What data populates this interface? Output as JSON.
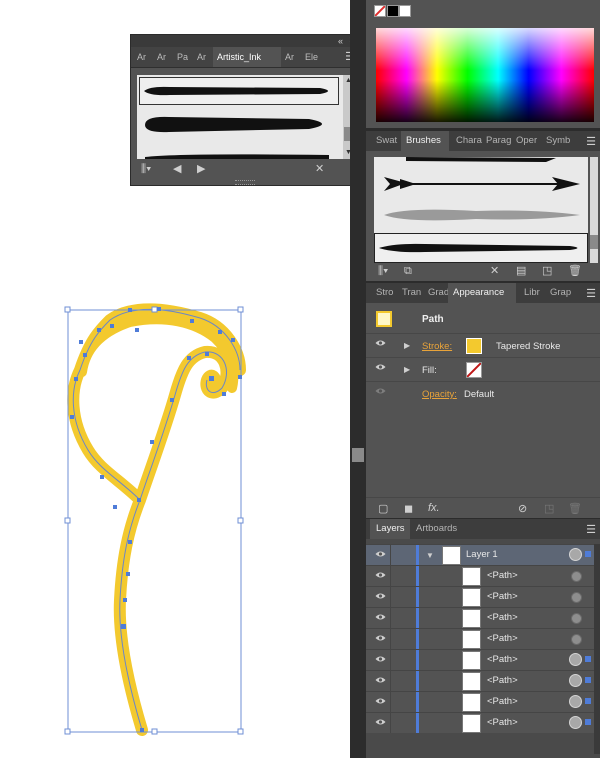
{
  "brush_library": {
    "tabs": [
      "Ar",
      "Ar",
      "Pa",
      "Ar",
      "Artistic_Ink",
      "Ar",
      "Ele"
    ],
    "active_tab": "Artistic_Ink"
  },
  "brushes_panel": {
    "tabs": [
      "Swat",
      "Brushes",
      "Chara",
      "Parag",
      "Oper",
      "Symb"
    ],
    "active_tab": "Brushes"
  },
  "appearance_panel": {
    "tabs": [
      "Stro",
      "Tran",
      "Grad",
      "Appearance",
      "Libr",
      "Grap"
    ],
    "active_tab": "Appearance",
    "object": "Path",
    "stroke_label": "Stroke:",
    "stroke_value": "Tapered Stroke",
    "stroke_color": "#f3c92e",
    "fill_label": "Fill:",
    "opacity_label": "Opacity:",
    "opacity_value": "Default",
    "fx_label": "fx."
  },
  "layers_panel": {
    "tabs": [
      "Layers",
      "Artboards"
    ],
    "active_tab": "Layers",
    "layer_name": "Layer 1",
    "items": [
      "<Path>",
      "<Path>",
      "<Path>",
      "<Path>",
      "<Path>",
      "<Path>",
      "<Path>",
      "<Path>"
    ]
  },
  "colors": {
    "stroke_yellow": "#f3c92e",
    "selection_blue": "#4f7cd8",
    "panel_bg": "#535353",
    "orange_link": "#e8a33a"
  }
}
